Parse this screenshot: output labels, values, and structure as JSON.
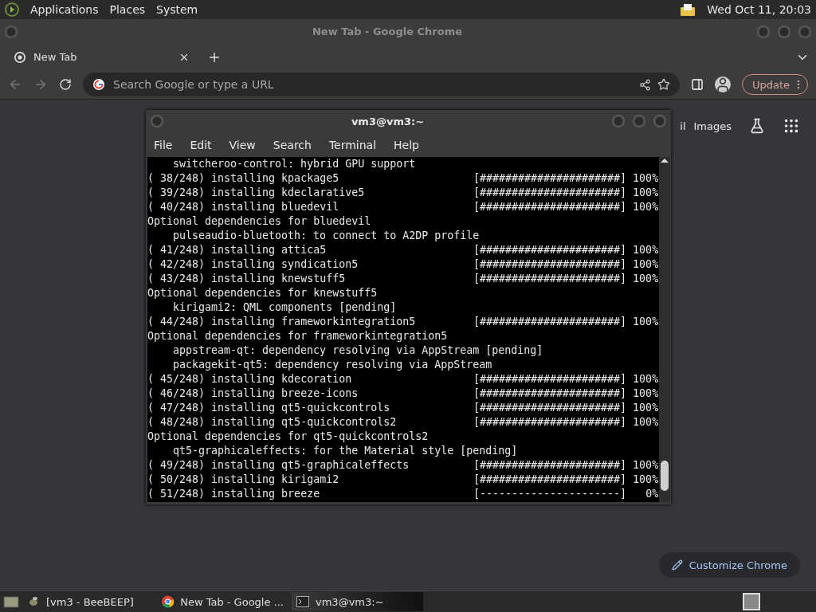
{
  "top_panel": {
    "menus": [
      "Applications",
      "Places",
      "System"
    ],
    "clock": "Wed Oct 11, 20:03"
  },
  "chrome": {
    "title": "New Tab - Google Chrome",
    "tabs": [
      {
        "label": "New Tab",
        "selected": true
      }
    ],
    "address_placeholder": "Search Google or type a URL",
    "update_button": "Update",
    "page_links": [
      "il",
      "Images"
    ],
    "customize_button": "Customize Chrome"
  },
  "terminal": {
    "title": "vm3@vm3:~",
    "menus": [
      "File",
      "Edit",
      "View",
      "Search",
      "Terminal",
      "Help"
    ],
    "lines": [
      {
        "kind": "note",
        "text": "switcheroo-control: hybrid GPU support"
      },
      {
        "kind": "install",
        "text": "( 38/248) installing kpackage5",
        "bar": "[######################]",
        "percent": "100%"
      },
      {
        "kind": "install",
        "text": "( 39/248) installing kdeclarative5",
        "bar": "[######################]",
        "percent": "100%"
      },
      {
        "kind": "install",
        "text": "( 40/248) installing bluedevil",
        "bar": "[######################]",
        "percent": "100%"
      },
      {
        "kind": "heading",
        "text": "Optional dependencies for bluedevil"
      },
      {
        "kind": "note",
        "text": "pulseaudio-bluetooth: to connect to A2DP profile"
      },
      {
        "kind": "install",
        "text": "( 41/248) installing attica5",
        "bar": "[######################]",
        "percent": "100%"
      },
      {
        "kind": "install",
        "text": "( 42/248) installing syndication5",
        "bar": "[######################]",
        "percent": "100%"
      },
      {
        "kind": "install",
        "text": "( 43/248) installing knewstuff5",
        "bar": "[######################]",
        "percent": "100%"
      },
      {
        "kind": "heading",
        "text": "Optional dependencies for knewstuff5"
      },
      {
        "kind": "note",
        "text": "kirigami2: QML components [pending]"
      },
      {
        "kind": "install",
        "text": "( 44/248) installing frameworkintegration5",
        "bar": "[######################]",
        "percent": "100%"
      },
      {
        "kind": "heading",
        "text": "Optional dependencies for frameworkintegration5"
      },
      {
        "kind": "note",
        "text": "appstream-qt: dependency resolving via AppStream [pending]"
      },
      {
        "kind": "note",
        "text": "packagekit-qt5: dependency resolving via AppStream"
      },
      {
        "kind": "install",
        "text": "( 45/248) installing kdecoration",
        "bar": "[######################]",
        "percent": "100%"
      },
      {
        "kind": "install",
        "text": "( 46/248) installing breeze-icons",
        "bar": "[######################]",
        "percent": "100%"
      },
      {
        "kind": "install",
        "text": "( 47/248) installing qt5-quickcontrols",
        "bar": "[######################]",
        "percent": "100%"
      },
      {
        "kind": "install",
        "text": "( 48/248) installing qt5-quickcontrols2",
        "bar": "[######################]",
        "percent": "100%"
      },
      {
        "kind": "heading",
        "text": "Optional dependencies for qt5-quickcontrols2"
      },
      {
        "kind": "note",
        "text": "qt5-graphicaleffects: for the Material style [pending]"
      },
      {
        "kind": "install",
        "text": "( 49/248) installing qt5-graphicaleffects",
        "bar": "[######################]",
        "percent": "100%"
      },
      {
        "kind": "install",
        "text": "( 50/248) installing kirigami2",
        "bar": "[######################]",
        "percent": "100%"
      },
      {
        "kind": "install",
        "text": "( 51/248) installing breeze",
        "bar": "[----------------------]",
        "percent": "0%"
      }
    ]
  },
  "taskbar": [
    {
      "label": "[vm3 - BeeBEEP]",
      "kind": "beebeep",
      "selected": false
    },
    {
      "label": "New Tab - Google ...",
      "kind": "chrome",
      "selected": false
    },
    {
      "label": "vm3@vm3:~",
      "kind": "terminal",
      "selected": true
    }
  ]
}
